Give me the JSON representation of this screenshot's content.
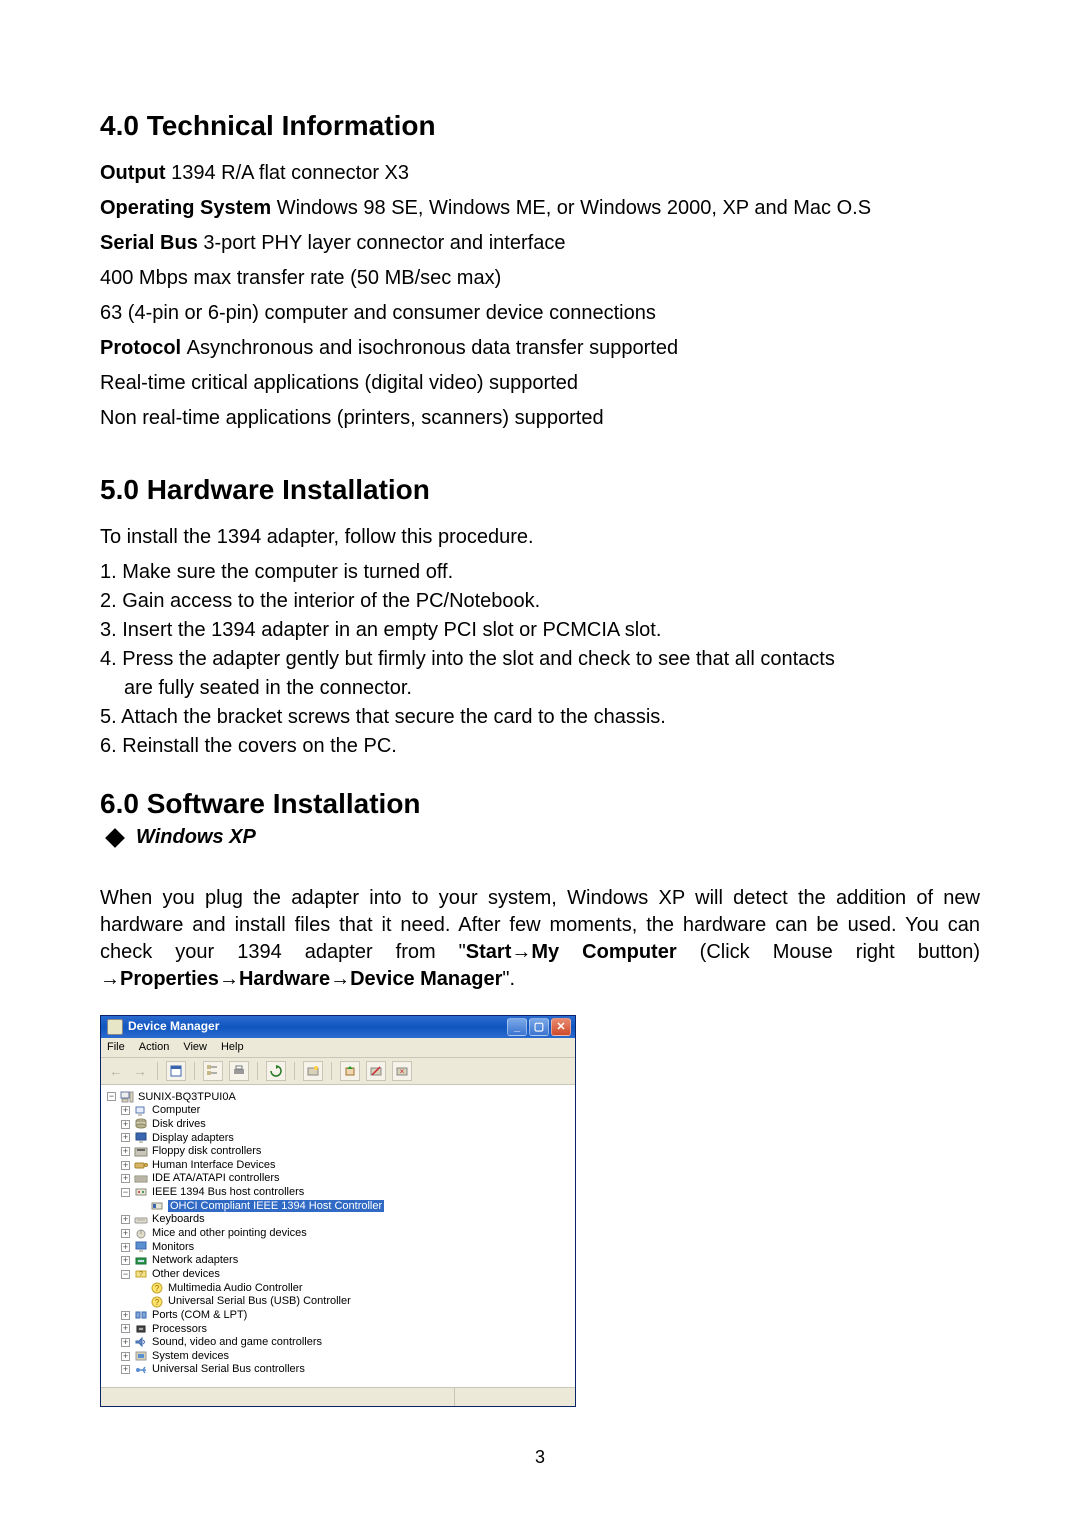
{
  "sections": {
    "s4": {
      "title": "4.0 Technical Information",
      "lines": [
        [
          {
            "b": true,
            "t": "Output "
          },
          {
            "b": false,
            "t": "1394 R/A flat connector X3"
          }
        ],
        [
          {
            "b": true,
            "t": "Operating System "
          },
          {
            "b": false,
            "t": "Windows 98 SE, Windows ME, or Windows 2000, XP and Mac O.S"
          }
        ],
        [
          {
            "b": true,
            "t": "Serial Bus "
          },
          {
            "b": false,
            "t": "3-port PHY layer connector and interface"
          }
        ],
        [
          {
            "b": false,
            "t": "400 Mbps max transfer rate (50 MB/sec max)"
          }
        ],
        [
          {
            "b": false,
            "t": "63 (4-pin or 6-pin) computer and consumer device connections"
          }
        ],
        [
          {
            "b": true,
            "t": "Protocol "
          },
          {
            "b": false,
            "t": "Asynchronous and isochronous data transfer supported"
          }
        ],
        [
          {
            "b": false,
            "t": "Real-time critical applications (digital video) supported"
          }
        ],
        [
          {
            "b": false,
            "t": "Non real-time applications (printers, scanners) supported"
          }
        ]
      ]
    },
    "s5": {
      "title": "5.0 Hardware Installation",
      "intro": "To install the 1394 adapter, follow this procedure.",
      "steps": [
        "1. Make sure the computer is turned off.",
        "2. Gain access to the interior of the PC/Notebook.",
        "3. Insert the 1394 adapter in an empty PCI slot or PCMCIA slot.",
        "4. Press the adapter gently but firmly into the slot and check to see that all contacts are fully seated in the connector.",
        "5. Attach the bracket screws that secure the card to the chassis.",
        "6. Reinstall the covers on the PC."
      ]
    },
    "s6": {
      "title": "6.0 Software Installation",
      "subhead": "Windows XP",
      "para_parts": [
        {
          "b": false,
          "t": "When you plug the adapter into to your system, Windows XP will detect the addition of new hardware and install files that it need. After few moments, the hardware can be used. You can check your 1394 adapter from \""
        },
        {
          "b": true,
          "t": "Start"
        },
        {
          "b": false,
          "t": "→"
        },
        {
          "b": true,
          "t": "My Computer"
        },
        {
          "b": false,
          "t": " (Click Mouse right button) →"
        },
        {
          "b": true,
          "t": "Properties"
        },
        {
          "b": false,
          "t": "→"
        },
        {
          "b": true,
          "t": "Hardware"
        },
        {
          "b": false,
          "t": "→"
        },
        {
          "b": true,
          "t": "Device Manager"
        },
        {
          "b": false,
          "t": "\"."
        }
      ]
    }
  },
  "dm": {
    "title": "Device Manager",
    "menu": [
      "File",
      "Action",
      "View",
      "Help"
    ],
    "root": "SUNIX-BQ3TPUI0A",
    "nodes": [
      {
        "exp": "+",
        "icon": "computer",
        "label": "Computer",
        "indent": 1
      },
      {
        "exp": "+",
        "icon": "disk",
        "label": "Disk drives",
        "indent": 1
      },
      {
        "exp": "+",
        "icon": "display",
        "label": "Display adapters",
        "indent": 1
      },
      {
        "exp": "+",
        "icon": "floppy",
        "label": "Floppy disk controllers",
        "indent": 1
      },
      {
        "exp": "+",
        "icon": "hid",
        "label": "Human Interface Devices",
        "indent": 1
      },
      {
        "exp": "+",
        "icon": "ide",
        "label": "IDE ATA/ATAPI controllers",
        "indent": 1
      },
      {
        "exp": "-",
        "icon": "1394cat",
        "label": "IEEE 1394 Bus host controllers",
        "indent": 1
      },
      {
        "exp": "",
        "icon": "1394dev",
        "label": "OHCI Compliant IEEE 1394 Host Controller",
        "indent": 2,
        "sel": true
      },
      {
        "exp": "+",
        "icon": "keyboard",
        "label": "Keyboards",
        "indent": 1
      },
      {
        "exp": "+",
        "icon": "mouse",
        "label": "Mice and other pointing devices",
        "indent": 1
      },
      {
        "exp": "+",
        "icon": "monitor",
        "label": "Monitors",
        "indent": 1
      },
      {
        "exp": "+",
        "icon": "network",
        "label": "Network adapters",
        "indent": 1
      },
      {
        "exp": "-",
        "icon": "other",
        "label": "Other devices",
        "indent": 1
      },
      {
        "exp": "",
        "icon": "unknown",
        "label": "Multimedia Audio Controller",
        "indent": 2
      },
      {
        "exp": "",
        "icon": "unknown",
        "label": "Universal Serial Bus (USB) Controller",
        "indent": 2
      },
      {
        "exp": "+",
        "icon": "ports",
        "label": "Ports (COM & LPT)",
        "indent": 1
      },
      {
        "exp": "+",
        "icon": "cpu",
        "label": "Processors",
        "indent": 1
      },
      {
        "exp": "+",
        "icon": "sound",
        "label": "Sound, video and game controllers",
        "indent": 1
      },
      {
        "exp": "+",
        "icon": "system",
        "label": "System devices",
        "indent": 1
      },
      {
        "exp": "+",
        "icon": "usb",
        "label": "Universal Serial Bus controllers",
        "indent": 1
      }
    ]
  },
  "page_number": "3"
}
